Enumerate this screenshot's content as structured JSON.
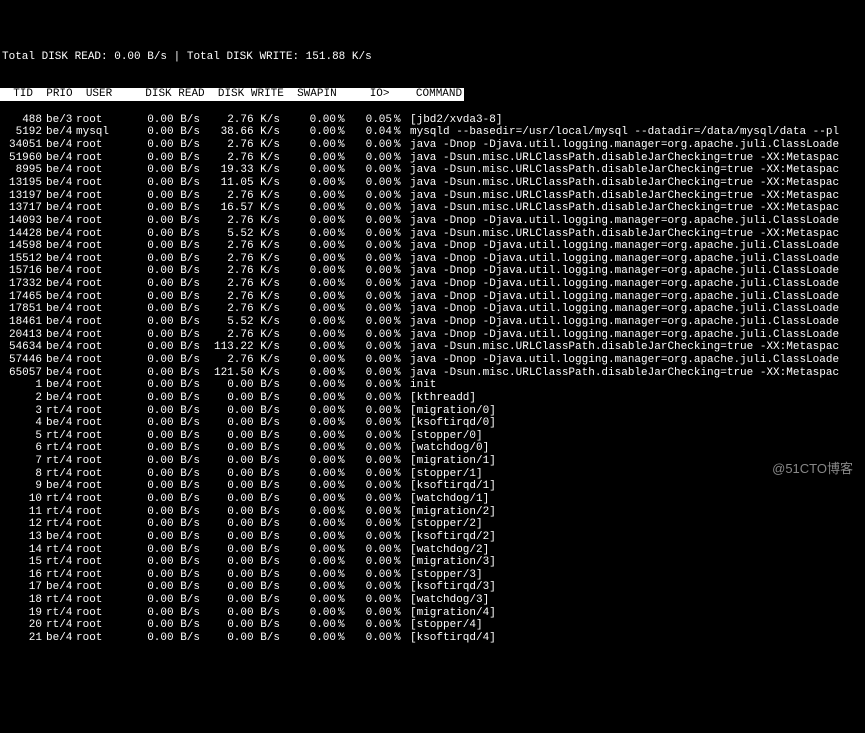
{
  "summary": {
    "total_read_label": "Total DISK READ: ",
    "total_read_value": "0.00 B/s",
    "sep": " | ",
    "total_write_label": "Total DISK WRITE: ",
    "total_write_value": "151.88 K/s"
  },
  "headers": {
    "tid": "  TID",
    "prio": "  PRIO",
    "user": "  USER",
    "dread": "     DISK READ",
    "dwrite": "  DISK WRITE",
    "swap": "  SWAPIN",
    "io": "     IO>",
    "cmd": "    COMMAND"
  },
  "rows": [
    {
      "tid": "488",
      "prio": "be/3",
      "user": "root",
      "dr": "0.00 B/s",
      "dw": "2.76 K/s",
      "sw": "0.00",
      "io": "0.05",
      "cmd": "[jbd2/xvda3-8]"
    },
    {
      "tid": "5192",
      "prio": "be/4",
      "user": "mysql",
      "dr": "0.00 B/s",
      "dw": "38.66 K/s",
      "sw": "0.00",
      "io": "0.04",
      "cmd": "mysqld --basedir=/usr/local/mysql --datadir=/data/mysql/data --pl"
    },
    {
      "tid": "34051",
      "prio": "be/4",
      "user": "root",
      "dr": "0.00 B/s",
      "dw": "2.76 K/s",
      "sw": "0.00",
      "io": "0.00",
      "cmd": "java -Dnop -Djava.util.logging.manager=org.apache.juli.ClassLoade"
    },
    {
      "tid": "51960",
      "prio": "be/4",
      "user": "root",
      "dr": "0.00 B/s",
      "dw": "2.76 K/s",
      "sw": "0.00",
      "io": "0.00",
      "cmd": "java -Dsun.misc.URLClassPath.disableJarChecking=true -XX:Metaspac"
    },
    {
      "tid": "8995",
      "prio": "be/4",
      "user": "root",
      "dr": "0.00 B/s",
      "dw": "19.33 K/s",
      "sw": "0.00",
      "io": "0.00",
      "cmd": "java -Dsun.misc.URLClassPath.disableJarChecking=true -XX:Metaspac"
    },
    {
      "tid": "13195",
      "prio": "be/4",
      "user": "root",
      "dr": "0.00 B/s",
      "dw": "11.05 K/s",
      "sw": "0.00",
      "io": "0.00",
      "cmd": "java -Dsun.misc.URLClassPath.disableJarChecking=true -XX:Metaspac"
    },
    {
      "tid": "13197",
      "prio": "be/4",
      "user": "root",
      "dr": "0.00 B/s",
      "dw": "2.76 K/s",
      "sw": "0.00",
      "io": "0.00",
      "cmd": "java -Dsun.misc.URLClassPath.disableJarChecking=true -XX:Metaspac"
    },
    {
      "tid": "13717",
      "prio": "be/4",
      "user": "root",
      "dr": "0.00 B/s",
      "dw": "16.57 K/s",
      "sw": "0.00",
      "io": "0.00",
      "cmd": "java -Dsun.misc.URLClassPath.disableJarChecking=true -XX:Metaspac"
    },
    {
      "tid": "14093",
      "prio": "be/4",
      "user": "root",
      "dr": "0.00 B/s",
      "dw": "2.76 K/s",
      "sw": "0.00",
      "io": "0.00",
      "cmd": "java -Dnop -Djava.util.logging.manager=org.apache.juli.ClassLoade"
    },
    {
      "tid": "14428",
      "prio": "be/4",
      "user": "root",
      "dr": "0.00 B/s",
      "dw": "5.52 K/s",
      "sw": "0.00",
      "io": "0.00",
      "cmd": "java -Dsun.misc.URLClassPath.disableJarChecking=true -XX:Metaspac"
    },
    {
      "tid": "14598",
      "prio": "be/4",
      "user": "root",
      "dr": "0.00 B/s",
      "dw": "2.76 K/s",
      "sw": "0.00",
      "io": "0.00",
      "cmd": "java -Dnop -Djava.util.logging.manager=org.apache.juli.ClassLoade"
    },
    {
      "tid": "15512",
      "prio": "be/4",
      "user": "root",
      "dr": "0.00 B/s",
      "dw": "2.76 K/s",
      "sw": "0.00",
      "io": "0.00",
      "cmd": "java -Dnop -Djava.util.logging.manager=org.apache.juli.ClassLoade"
    },
    {
      "tid": "15716",
      "prio": "be/4",
      "user": "root",
      "dr": "0.00 B/s",
      "dw": "2.76 K/s",
      "sw": "0.00",
      "io": "0.00",
      "cmd": "java -Dnop -Djava.util.logging.manager=org.apache.juli.ClassLoade"
    },
    {
      "tid": "17332",
      "prio": "be/4",
      "user": "root",
      "dr": "0.00 B/s",
      "dw": "2.76 K/s",
      "sw": "0.00",
      "io": "0.00",
      "cmd": "java -Dnop -Djava.util.logging.manager=org.apache.juli.ClassLoade"
    },
    {
      "tid": "17465",
      "prio": "be/4",
      "user": "root",
      "dr": "0.00 B/s",
      "dw": "2.76 K/s",
      "sw": "0.00",
      "io": "0.00",
      "cmd": "java -Dnop -Djava.util.logging.manager=org.apache.juli.ClassLoade"
    },
    {
      "tid": "17851",
      "prio": "be/4",
      "user": "root",
      "dr": "0.00 B/s",
      "dw": "2.76 K/s",
      "sw": "0.00",
      "io": "0.00",
      "cmd": "java -Dnop -Djava.util.logging.manager=org.apache.juli.ClassLoade"
    },
    {
      "tid": "18461",
      "prio": "be/4",
      "user": "root",
      "dr": "0.00 B/s",
      "dw": "5.52 K/s",
      "sw": "0.00",
      "io": "0.00",
      "cmd": "java -Dnop -Djava.util.logging.manager=org.apache.juli.ClassLoade"
    },
    {
      "tid": "20413",
      "prio": "be/4",
      "user": "root",
      "dr": "0.00 B/s",
      "dw": "2.76 K/s",
      "sw": "0.00",
      "io": "0.00",
      "cmd": "java -Dnop -Djava.util.logging.manager=org.apache.juli.ClassLoade"
    },
    {
      "tid": "54634",
      "prio": "be/4",
      "user": "root",
      "dr": "0.00 B/s",
      "dw": "113.22 K/s",
      "sw": "0.00",
      "io": "0.00",
      "cmd": "java -Dsun.misc.URLClassPath.disableJarChecking=true -XX:Metaspac"
    },
    {
      "tid": "57446",
      "prio": "be/4",
      "user": "root",
      "dr": "0.00 B/s",
      "dw": "2.76 K/s",
      "sw": "0.00",
      "io": "0.00",
      "cmd": "java -Dnop -Djava.util.logging.manager=org.apache.juli.ClassLoade"
    },
    {
      "tid": "65057",
      "prio": "be/4",
      "user": "root",
      "dr": "0.00 B/s",
      "dw": "121.50 K/s",
      "sw": "0.00",
      "io": "0.00",
      "cmd": "java -Dsun.misc.URLClassPath.disableJarChecking=true -XX:Metaspac"
    },
    {
      "tid": "1",
      "prio": "be/4",
      "user": "root",
      "dr": "0.00 B/s",
      "dw": "0.00 B/s",
      "sw": "0.00",
      "io": "0.00",
      "cmd": "init"
    },
    {
      "tid": "2",
      "prio": "be/4",
      "user": "root",
      "dr": "0.00 B/s",
      "dw": "0.00 B/s",
      "sw": "0.00",
      "io": "0.00",
      "cmd": "[kthreadd]"
    },
    {
      "tid": "3",
      "prio": "rt/4",
      "user": "root",
      "dr": "0.00 B/s",
      "dw": "0.00 B/s",
      "sw": "0.00",
      "io": "0.00",
      "cmd": "[migration/0]"
    },
    {
      "tid": "4",
      "prio": "be/4",
      "user": "root",
      "dr": "0.00 B/s",
      "dw": "0.00 B/s",
      "sw": "0.00",
      "io": "0.00",
      "cmd": "[ksoftirqd/0]"
    },
    {
      "tid": "5",
      "prio": "rt/4",
      "user": "root",
      "dr": "0.00 B/s",
      "dw": "0.00 B/s",
      "sw": "0.00",
      "io": "0.00",
      "cmd": "[stopper/0]"
    },
    {
      "tid": "6",
      "prio": "rt/4",
      "user": "root",
      "dr": "0.00 B/s",
      "dw": "0.00 B/s",
      "sw": "0.00",
      "io": "0.00",
      "cmd": "[watchdog/0]"
    },
    {
      "tid": "7",
      "prio": "rt/4",
      "user": "root",
      "dr": "0.00 B/s",
      "dw": "0.00 B/s",
      "sw": "0.00",
      "io": "0.00",
      "cmd": "[migration/1]"
    },
    {
      "tid": "8",
      "prio": "rt/4",
      "user": "root",
      "dr": "0.00 B/s",
      "dw": "0.00 B/s",
      "sw": "0.00",
      "io": "0.00",
      "cmd": "[stopper/1]"
    },
    {
      "tid": "9",
      "prio": "be/4",
      "user": "root",
      "dr": "0.00 B/s",
      "dw": "0.00 B/s",
      "sw": "0.00",
      "io": "0.00",
      "cmd": "[ksoftirqd/1]"
    },
    {
      "tid": "10",
      "prio": "rt/4",
      "user": "root",
      "dr": "0.00 B/s",
      "dw": "0.00 B/s",
      "sw": "0.00",
      "io": "0.00",
      "cmd": "[watchdog/1]"
    },
    {
      "tid": "11",
      "prio": "rt/4",
      "user": "root",
      "dr": "0.00 B/s",
      "dw": "0.00 B/s",
      "sw": "0.00",
      "io": "0.00",
      "cmd": "[migration/2]"
    },
    {
      "tid": "12",
      "prio": "rt/4",
      "user": "root",
      "dr": "0.00 B/s",
      "dw": "0.00 B/s",
      "sw": "0.00",
      "io": "0.00",
      "cmd": "[stopper/2]"
    },
    {
      "tid": "13",
      "prio": "be/4",
      "user": "root",
      "dr": "0.00 B/s",
      "dw": "0.00 B/s",
      "sw": "0.00",
      "io": "0.00",
      "cmd": "[ksoftirqd/2]"
    },
    {
      "tid": "14",
      "prio": "rt/4",
      "user": "root",
      "dr": "0.00 B/s",
      "dw": "0.00 B/s",
      "sw": "0.00",
      "io": "0.00",
      "cmd": "[watchdog/2]"
    },
    {
      "tid": "15",
      "prio": "rt/4",
      "user": "root",
      "dr": "0.00 B/s",
      "dw": "0.00 B/s",
      "sw": "0.00",
      "io": "0.00",
      "cmd": "[migration/3]"
    },
    {
      "tid": "16",
      "prio": "rt/4",
      "user": "root",
      "dr": "0.00 B/s",
      "dw": "0.00 B/s",
      "sw": "0.00",
      "io": "0.00",
      "cmd": "[stopper/3]"
    },
    {
      "tid": "17",
      "prio": "be/4",
      "user": "root",
      "dr": "0.00 B/s",
      "dw": "0.00 B/s",
      "sw": "0.00",
      "io": "0.00",
      "cmd": "[ksoftirqd/3]"
    },
    {
      "tid": "18",
      "prio": "rt/4",
      "user": "root",
      "dr": "0.00 B/s",
      "dw": "0.00 B/s",
      "sw": "0.00",
      "io": "0.00",
      "cmd": "[watchdog/3]"
    },
    {
      "tid": "19",
      "prio": "rt/4",
      "user": "root",
      "dr": "0.00 B/s",
      "dw": "0.00 B/s",
      "sw": "0.00",
      "io": "0.00",
      "cmd": "[migration/4]"
    },
    {
      "tid": "20",
      "prio": "rt/4",
      "user": "root",
      "dr": "0.00 B/s",
      "dw": "0.00 B/s",
      "sw": "0.00",
      "io": "0.00",
      "cmd": "[stopper/4]"
    },
    {
      "tid": "21",
      "prio": "be/4",
      "user": "root",
      "dr": "0.00 B/s",
      "dw": "0.00 B/s",
      "sw": "0.00",
      "io": "0.00",
      "cmd": "[ksoftirqd/4]"
    }
  ],
  "watermark": "@51CTO博客"
}
